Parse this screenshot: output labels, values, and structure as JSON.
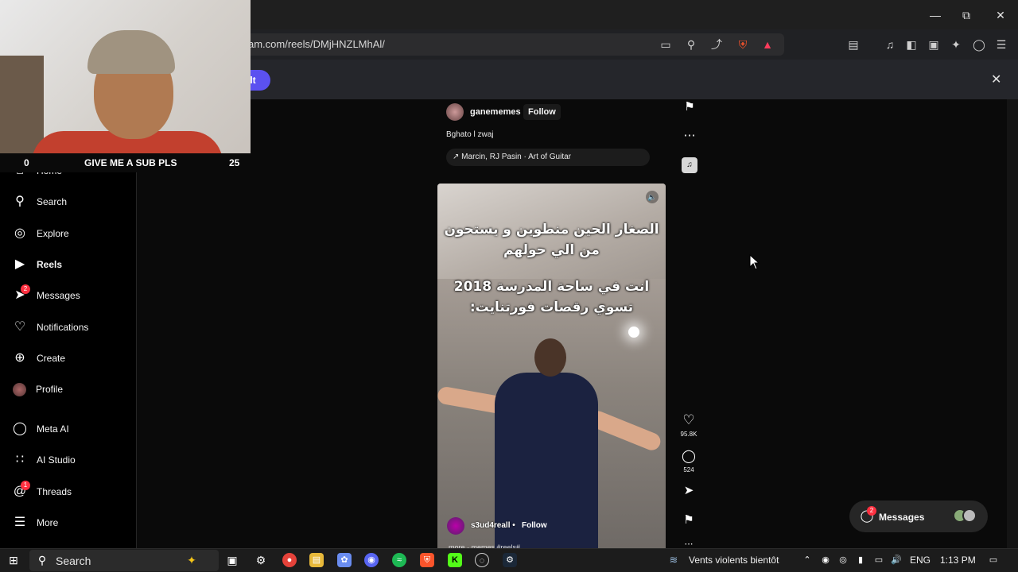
{
  "browser": {
    "url": "am.com/reels/DMjHNZLMhAl/",
    "infobar_button": "lt",
    "window_controls": [
      "minimize-icon",
      "restore-icon",
      "close-icon"
    ]
  },
  "webcam": {
    "left_count": "0",
    "caption": "GIVE ME A SUB PLS",
    "right_count": "25"
  },
  "sidebar": {
    "items": [
      {
        "label": "Home",
        "icon": "home-icon"
      },
      {
        "label": "Search",
        "icon": "search-icon"
      },
      {
        "label": "Explore",
        "icon": "compass-icon"
      },
      {
        "label": "Reels",
        "icon": "reels-icon"
      },
      {
        "label": "Messages",
        "icon": "send-icon",
        "badge": "2"
      },
      {
        "label": "Notifications",
        "icon": "heart-icon"
      },
      {
        "label": "Create",
        "icon": "plus-icon"
      },
      {
        "label": "Profile",
        "icon": "avatar"
      },
      {
        "label": "Meta AI",
        "icon": "meta-ai-icon"
      },
      {
        "label": "AI Studio",
        "icon": "ai-studio-icon"
      },
      {
        "label": "Threads",
        "icon": "threads-icon",
        "badge": "1"
      },
      {
        "label": "More",
        "icon": "menu-icon"
      }
    ]
  },
  "reel": {
    "username": "ganememes",
    "separator": "•",
    "follow": "Follow",
    "caption": "Bghato l zwaj",
    "audio": "Marcin, RJ Pasin · Art of Guitar",
    "overlay_line1": "الصغار الحين منطوين و يستحون",
    "overlay_line2": "من الي حولهم",
    "overlay_line3": "انت في ساحة المدرسة 2018",
    "overlay_line4": "تسوي رقصات فورتنايت:",
    "video_user": "s3ud4reall",
    "video_follow": "Follow",
    "video_more": "more · memes #reels# ...",
    "likes": "95.8K",
    "comments": "524"
  },
  "messages_pill": {
    "label": "Messages",
    "badge": "2"
  },
  "taskbar": {
    "search_label": "Search",
    "weather": "Vents violents bientôt",
    "language": "ENG",
    "time": "1:13 PM"
  }
}
